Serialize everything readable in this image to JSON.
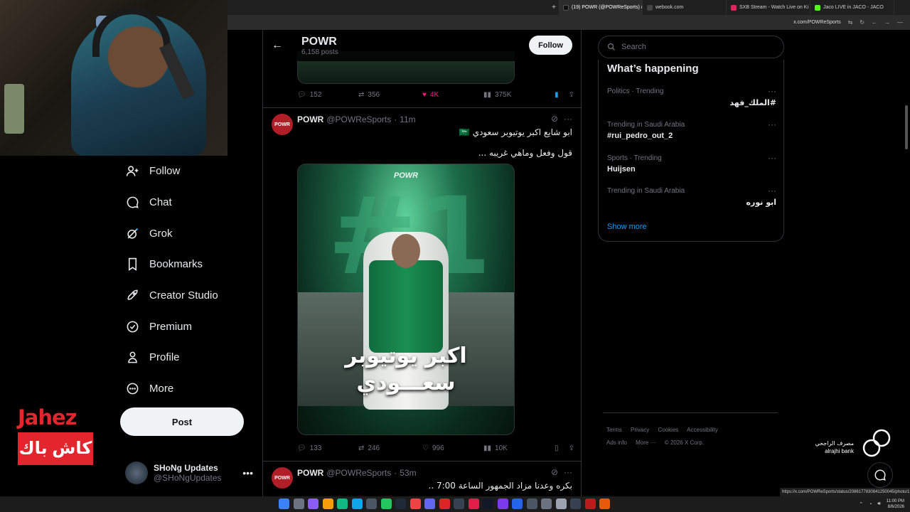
{
  "browser": {
    "tabs": [
      {
        "label": "(19) POWR (@POWReSports) /",
        "active": true,
        "color": "#111111"
      },
      {
        "label": "webook.com",
        "active": false,
        "color": "#444444"
      },
      {
        "label": "SXB Stream - Watch Live on Ki",
        "active": false,
        "color": "#e0245e"
      },
      {
        "label": "Jaco LIVE in JACO - JACO",
        "active": false,
        "color": "#53fc18"
      }
    ],
    "url": "x.com/POWReSports",
    "status_url": "https://x.com/POWReSports/status/2086177830841250045/photo/1"
  },
  "nav": {
    "items": [
      {
        "label": "Follow",
        "icon": "follow-icon"
      },
      {
        "label": "Chat",
        "icon": "chat-icon"
      },
      {
        "label": "Grok",
        "icon": "grok-icon"
      },
      {
        "label": "Bookmarks",
        "icon": "bookmark-icon"
      },
      {
        "label": "Creator Studio",
        "icon": "rocket-icon"
      },
      {
        "label": "Premium",
        "icon": "verified-icon"
      },
      {
        "label": "Profile",
        "icon": "person-icon"
      },
      {
        "label": "More",
        "icon": "more-circle-icon"
      }
    ],
    "post_label": "Post"
  },
  "account": {
    "name": "SHoNg Updates",
    "handle": "@SHoNgUpdates"
  },
  "ad": {
    "brand": "Jahez",
    "tagline": "كاش باك"
  },
  "header": {
    "title": "POWR",
    "subtitle": "6,158 posts",
    "follow_label": "Follow"
  },
  "prev_post": {
    "replies": "152",
    "reposts": "356",
    "likes": "4K",
    "views": "375K"
  },
  "posts": [
    {
      "name": "POWR",
      "handle": "@POWReSports",
      "time": "11m",
      "avatar": "POWR",
      "line1": "ابو شايع اكبر يوتيوبر سعودي 🇸🇦",
      "line2": "قول وفعل وماهي غريبه ...",
      "poster": {
        "logo": "POWR",
        "number": "#1",
        "title1": "اكبر يوتيوبر",
        "title2": "سعـــودي"
      },
      "replies": "133",
      "reposts": "246",
      "likes": "996",
      "views": "10K"
    },
    {
      "name": "POWR",
      "handle": "@POWReSports",
      "time": "53m",
      "avatar": "POWR",
      "line1": "بكره وعدنا مزاد الجمهور الساعة 7:00 .."
    }
  ],
  "search": {
    "placeholder": "Search"
  },
  "trends": {
    "title": "What’s happening",
    "items": [
      {
        "category": "Politics · Trending",
        "name": "#الملك_فهد",
        "rtl": true
      },
      {
        "category": "Trending in Saudi Arabia",
        "name": "#rui_pedro_out_2",
        "rtl": false
      },
      {
        "category": "Sports · Trending",
        "name": "Huijsen",
        "rtl": false
      },
      {
        "category": "Trending in Saudi Arabia",
        "name": "ابو نوره",
        "rtl": true
      }
    ],
    "show_more": "Show more"
  },
  "footer": {
    "links": [
      "Terms",
      "Privacy",
      "Cookies",
      "Accessibility",
      "Ads info",
      "More ···"
    ],
    "copyright": "© 2026 X Corp."
  },
  "branding": {
    "alrajhi_ar": "مصرف الراجحي",
    "alrajhi_en": "alrajhi bank"
  },
  "taskbar": {
    "time": "11:00 PM",
    "date": "8/6/2026"
  },
  "colors": {
    "accent": "#1d9bf0",
    "like": "#f91880",
    "bookmark": "#1d9bf0",
    "jahez": "#e3262e"
  }
}
